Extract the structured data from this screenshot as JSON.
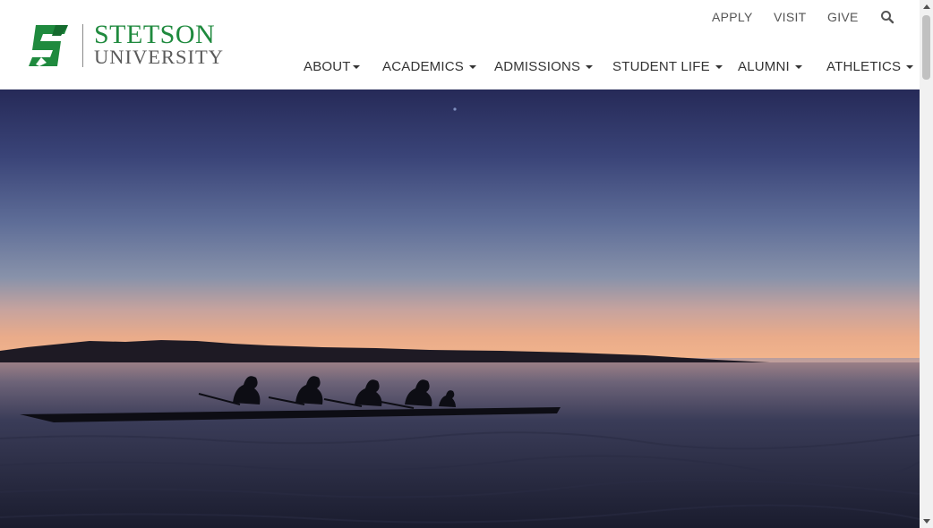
{
  "brand": {
    "name_line1": "STETSON",
    "name_line2": "UNIVERSITY",
    "logo_mark_letter": "S",
    "primary_color": "#1f8a3e",
    "secondary_color": "#5a5a5a"
  },
  "utility_nav": {
    "items": [
      {
        "label": "APPLY"
      },
      {
        "label": "VISIT"
      },
      {
        "label": "GIVE"
      }
    ],
    "search_icon": "search-icon"
  },
  "main_nav": {
    "items": [
      {
        "label": "ABOUT"
      },
      {
        "label": "ACADEMICS"
      },
      {
        "label": "ADMISSIONS"
      },
      {
        "label": "STUDENT LIFE"
      },
      {
        "label": "ALUMNI"
      },
      {
        "label": "ATHLETICS"
      }
    ]
  },
  "hero": {
    "image_subject": "rowing crew silhouetted on a lake at sunset",
    "sky_color_top": "#262a58",
    "horizon_color": "#f0b890",
    "water_color": "#1a1c2a"
  }
}
